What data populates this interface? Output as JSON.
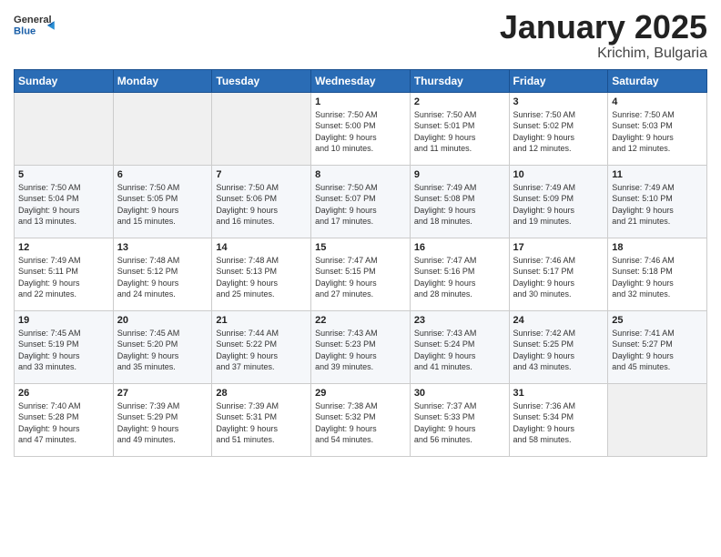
{
  "header": {
    "logo_general": "General",
    "logo_blue": "Blue",
    "month": "January 2025",
    "location": "Krichim, Bulgaria"
  },
  "weekdays": [
    "Sunday",
    "Monday",
    "Tuesday",
    "Wednesday",
    "Thursday",
    "Friday",
    "Saturday"
  ],
  "weeks": [
    [
      {
        "day": "",
        "info": ""
      },
      {
        "day": "",
        "info": ""
      },
      {
        "day": "",
        "info": ""
      },
      {
        "day": "1",
        "info": "Sunrise: 7:50 AM\nSunset: 5:00 PM\nDaylight: 9 hours\nand 10 minutes."
      },
      {
        "day": "2",
        "info": "Sunrise: 7:50 AM\nSunset: 5:01 PM\nDaylight: 9 hours\nand 11 minutes."
      },
      {
        "day": "3",
        "info": "Sunrise: 7:50 AM\nSunset: 5:02 PM\nDaylight: 9 hours\nand 12 minutes."
      },
      {
        "day": "4",
        "info": "Sunrise: 7:50 AM\nSunset: 5:03 PM\nDaylight: 9 hours\nand 12 minutes."
      }
    ],
    [
      {
        "day": "5",
        "info": "Sunrise: 7:50 AM\nSunset: 5:04 PM\nDaylight: 9 hours\nand 13 minutes."
      },
      {
        "day": "6",
        "info": "Sunrise: 7:50 AM\nSunset: 5:05 PM\nDaylight: 9 hours\nand 15 minutes."
      },
      {
        "day": "7",
        "info": "Sunrise: 7:50 AM\nSunset: 5:06 PM\nDaylight: 9 hours\nand 16 minutes."
      },
      {
        "day": "8",
        "info": "Sunrise: 7:50 AM\nSunset: 5:07 PM\nDaylight: 9 hours\nand 17 minutes."
      },
      {
        "day": "9",
        "info": "Sunrise: 7:49 AM\nSunset: 5:08 PM\nDaylight: 9 hours\nand 18 minutes."
      },
      {
        "day": "10",
        "info": "Sunrise: 7:49 AM\nSunset: 5:09 PM\nDaylight: 9 hours\nand 19 minutes."
      },
      {
        "day": "11",
        "info": "Sunrise: 7:49 AM\nSunset: 5:10 PM\nDaylight: 9 hours\nand 21 minutes."
      }
    ],
    [
      {
        "day": "12",
        "info": "Sunrise: 7:49 AM\nSunset: 5:11 PM\nDaylight: 9 hours\nand 22 minutes."
      },
      {
        "day": "13",
        "info": "Sunrise: 7:48 AM\nSunset: 5:12 PM\nDaylight: 9 hours\nand 24 minutes."
      },
      {
        "day": "14",
        "info": "Sunrise: 7:48 AM\nSunset: 5:13 PM\nDaylight: 9 hours\nand 25 minutes."
      },
      {
        "day": "15",
        "info": "Sunrise: 7:47 AM\nSunset: 5:15 PM\nDaylight: 9 hours\nand 27 minutes."
      },
      {
        "day": "16",
        "info": "Sunrise: 7:47 AM\nSunset: 5:16 PM\nDaylight: 9 hours\nand 28 minutes."
      },
      {
        "day": "17",
        "info": "Sunrise: 7:46 AM\nSunset: 5:17 PM\nDaylight: 9 hours\nand 30 minutes."
      },
      {
        "day": "18",
        "info": "Sunrise: 7:46 AM\nSunset: 5:18 PM\nDaylight: 9 hours\nand 32 minutes."
      }
    ],
    [
      {
        "day": "19",
        "info": "Sunrise: 7:45 AM\nSunset: 5:19 PM\nDaylight: 9 hours\nand 33 minutes."
      },
      {
        "day": "20",
        "info": "Sunrise: 7:45 AM\nSunset: 5:20 PM\nDaylight: 9 hours\nand 35 minutes."
      },
      {
        "day": "21",
        "info": "Sunrise: 7:44 AM\nSunset: 5:22 PM\nDaylight: 9 hours\nand 37 minutes."
      },
      {
        "day": "22",
        "info": "Sunrise: 7:43 AM\nSunset: 5:23 PM\nDaylight: 9 hours\nand 39 minutes."
      },
      {
        "day": "23",
        "info": "Sunrise: 7:43 AM\nSunset: 5:24 PM\nDaylight: 9 hours\nand 41 minutes."
      },
      {
        "day": "24",
        "info": "Sunrise: 7:42 AM\nSunset: 5:25 PM\nDaylight: 9 hours\nand 43 minutes."
      },
      {
        "day": "25",
        "info": "Sunrise: 7:41 AM\nSunset: 5:27 PM\nDaylight: 9 hours\nand 45 minutes."
      }
    ],
    [
      {
        "day": "26",
        "info": "Sunrise: 7:40 AM\nSunset: 5:28 PM\nDaylight: 9 hours\nand 47 minutes."
      },
      {
        "day": "27",
        "info": "Sunrise: 7:39 AM\nSunset: 5:29 PM\nDaylight: 9 hours\nand 49 minutes."
      },
      {
        "day": "28",
        "info": "Sunrise: 7:39 AM\nSunset: 5:31 PM\nDaylight: 9 hours\nand 51 minutes."
      },
      {
        "day": "29",
        "info": "Sunrise: 7:38 AM\nSunset: 5:32 PM\nDaylight: 9 hours\nand 54 minutes."
      },
      {
        "day": "30",
        "info": "Sunrise: 7:37 AM\nSunset: 5:33 PM\nDaylight: 9 hours\nand 56 minutes."
      },
      {
        "day": "31",
        "info": "Sunrise: 7:36 AM\nSunset: 5:34 PM\nDaylight: 9 hours\nand 58 minutes."
      },
      {
        "day": "",
        "info": ""
      }
    ]
  ]
}
